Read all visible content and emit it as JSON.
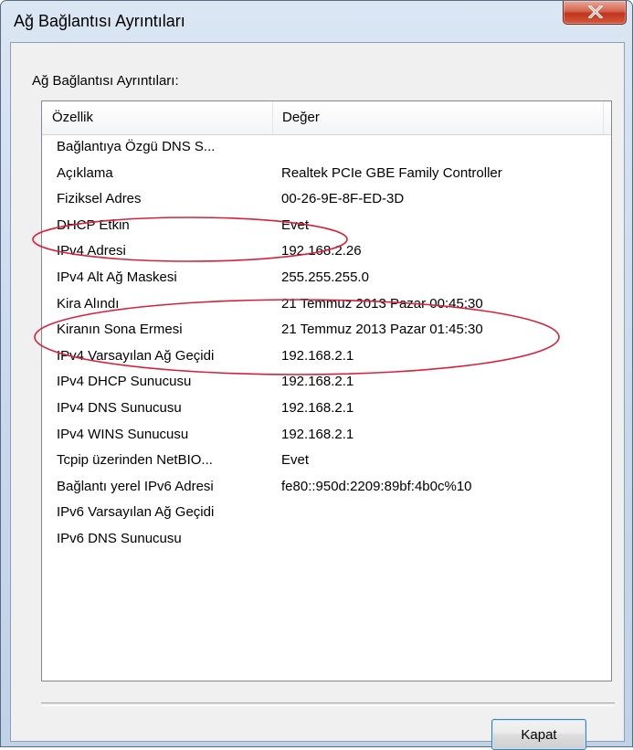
{
  "window": {
    "title": "Ağ Bağlantısı Ayrıntıları",
    "close_icon": "close-x-icon"
  },
  "group_label": "Ağ Bağlantısı Ayrıntıları:",
  "list": {
    "columns": {
      "property": "Özellik",
      "value": "Değer"
    },
    "rows": [
      {
        "property": "Bağlantıya Özgü DNS S...",
        "value": ""
      },
      {
        "property": "Açıklama",
        "value": "Realtek PCIe GBE Family Controller"
      },
      {
        "property": "Fiziksel Adres",
        "value": "00-26-9E-8F-ED-3D"
      },
      {
        "property": "DHCP Etkin",
        "value": "Evet"
      },
      {
        "property": "IPv4 Adresi",
        "value": "192.168.2.26"
      },
      {
        "property": "IPv4 Alt Ağ Maskesi",
        "value": "255.255.255.0"
      },
      {
        "property": "Kira Alındı",
        "value": "21 Temmuz 2013 Pazar 00:45:30"
      },
      {
        "property": "Kiranın Sona Ermesi",
        "value": "21 Temmuz 2013 Pazar 01:45:30"
      },
      {
        "property": "IPv4 Varsayılan Ağ Geçidi",
        "value": "192.168.2.1"
      },
      {
        "property": "IPv4 DHCP Sunucusu",
        "value": "192.168.2.1"
      },
      {
        "property": "IPv4 DNS Sunucusu",
        "value": "192.168.2.1"
      },
      {
        "property": "IPv4 WINS Sunucusu",
        "value": "192.168.2.1"
      },
      {
        "property": "Tcpip üzerinden NetBIO...",
        "value": "Evet"
      },
      {
        "property": "Bağlantı yerel IPv6 Adresi",
        "value": "fe80::950d:2209:89bf:4b0c%10"
      },
      {
        "property": "IPv6 Varsayılan Ağ Geçidi",
        "value": ""
      },
      {
        "property": "IPv6 DNS Sunucusu",
        "value": ""
      }
    ]
  },
  "close_button_label": "Kapat",
  "annotation_color": "#d9203a"
}
